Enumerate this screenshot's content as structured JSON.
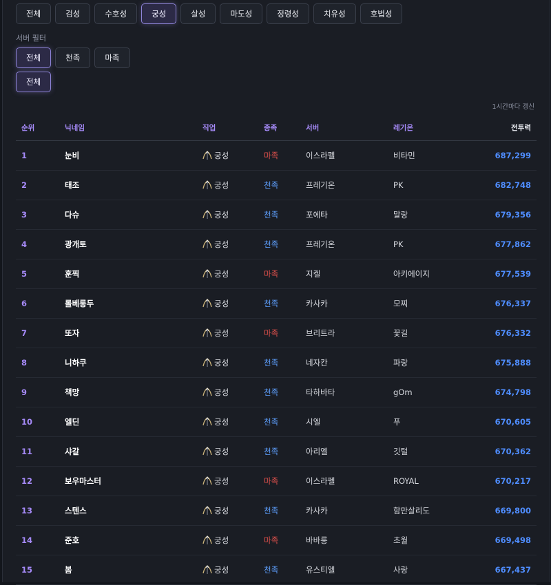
{
  "job_filters": [
    "전체",
    "검성",
    "수호성",
    "궁성",
    "살성",
    "마도성",
    "정령성",
    "치유성",
    "호법성"
  ],
  "job_active_index": 3,
  "server_filter_label": "서버 필터",
  "server_filters": [
    "전체",
    "천족",
    "마족"
  ],
  "server_active_index": 0,
  "region_filters": [
    "전체"
  ],
  "update_note": "1시간마다 갱신",
  "table": {
    "headers": {
      "rank": "순위",
      "name": "닉네임",
      "class": "직업",
      "race": "종족",
      "server": "서버",
      "legion": "레기온",
      "power": "전투력"
    },
    "rows": [
      {
        "rank": "1",
        "name": "눈비",
        "class": "궁성",
        "race": "마족",
        "race_type": "m",
        "server": "이스라펠",
        "legion": "비타민",
        "power": "687,299"
      },
      {
        "rank": "2",
        "name": "태조",
        "class": "궁성",
        "race": "천족",
        "race_type": "c",
        "server": "프레기온",
        "legion": "PK",
        "power": "682,748"
      },
      {
        "rank": "3",
        "name": "다슈",
        "class": "궁성",
        "race": "천족",
        "race_type": "c",
        "server": "포에타",
        "legion": "말랑",
        "power": "679,356"
      },
      {
        "rank": "4",
        "name": "광개토",
        "class": "궁성",
        "race": "천족",
        "race_type": "c",
        "server": "프레기온",
        "legion": "PK",
        "power": "677,862"
      },
      {
        "rank": "5",
        "name": "훈찍",
        "class": "궁성",
        "race": "마족",
        "race_type": "m",
        "server": "지켈",
        "legion": "아키에이지",
        "power": "677,539"
      },
      {
        "rank": "6",
        "name": "롤베롱두",
        "class": "궁성",
        "race": "천족",
        "race_type": "c",
        "server": "카사카",
        "legion": "모찌",
        "power": "676,337"
      },
      {
        "rank": "7",
        "name": "또자",
        "class": "궁성",
        "race": "마족",
        "race_type": "m",
        "server": "브리트라",
        "legion": "꽃길",
        "power": "676,332"
      },
      {
        "rank": "8",
        "name": "니하쿠",
        "class": "궁성",
        "race": "천족",
        "race_type": "c",
        "server": "네자칸",
        "legion": "파랑",
        "power": "675,888"
      },
      {
        "rank": "9",
        "name": "책망",
        "class": "궁성",
        "race": "천족",
        "race_type": "c",
        "server": "타하바타",
        "legion": "gOm",
        "power": "674,798"
      },
      {
        "rank": "10",
        "name": "엘딘",
        "class": "궁성",
        "race": "천족",
        "race_type": "c",
        "server": "시엘",
        "legion": "푸",
        "power": "670,605"
      },
      {
        "rank": "11",
        "name": "샤갈",
        "class": "궁성",
        "race": "천족",
        "race_type": "c",
        "server": "아리엘",
        "legion": "깃털",
        "power": "670,362"
      },
      {
        "rank": "12",
        "name": "보우마스터",
        "class": "궁성",
        "race": "마족",
        "race_type": "m",
        "server": "이스라펠",
        "legion": "ROYAL",
        "power": "670,217"
      },
      {
        "rank": "13",
        "name": "스텐스",
        "class": "궁성",
        "race": "천족",
        "race_type": "c",
        "server": "카사카",
        "legion": "함만살리도",
        "power": "669,800"
      },
      {
        "rank": "14",
        "name": "준호",
        "class": "궁성",
        "race": "마족",
        "race_type": "m",
        "server": "바바룽",
        "legion": "초월",
        "power": "669,498"
      },
      {
        "rank": "15",
        "name": "봄",
        "class": "궁성",
        "race": "천족",
        "race_type": "c",
        "server": "유스티엘",
        "legion": "사랑",
        "power": "667,437"
      }
    ]
  },
  "colors": {
    "accent": "#a78bfa",
    "race_m": "#e2514c",
    "race_c": "#5ea0ff",
    "power": "#4f8dff"
  },
  "icons": {
    "class_icon": "bow-icon"
  }
}
